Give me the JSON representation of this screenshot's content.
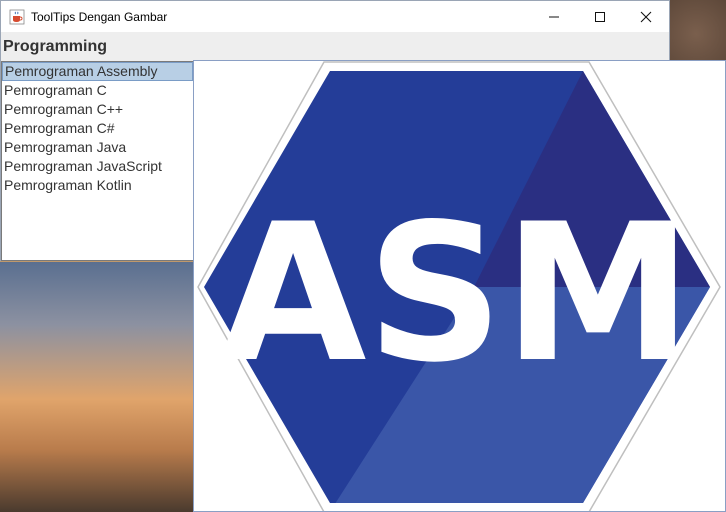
{
  "window": {
    "title": "ToolTips Dengan Gambar",
    "controls": {
      "minimize_glyph": "—",
      "maximize_glyph": "☐",
      "close_glyph": "✕"
    }
  },
  "heading": "Programming",
  "list": {
    "selected_index": 0,
    "items": [
      "Pemrograman Assembly",
      "Pemrograman C",
      "Pemrograman C++",
      "Pemrograman C#",
      "Pemrograman Java",
      "Pemrograman JavaScript",
      "Pemrograman Kotlin"
    ]
  },
  "tooltip": {
    "logo_text": "ASM",
    "colors": {
      "hex_dark": "#2a2f82",
      "hex_main": "#243d98",
      "hex_light": "#3a56a8",
      "outline": "#cccccc",
      "text": "#ffffff"
    }
  },
  "colors": {
    "selection_bg": "#b8cfe5",
    "window_bg": "#eeeeee",
    "text": "#333333"
  }
}
